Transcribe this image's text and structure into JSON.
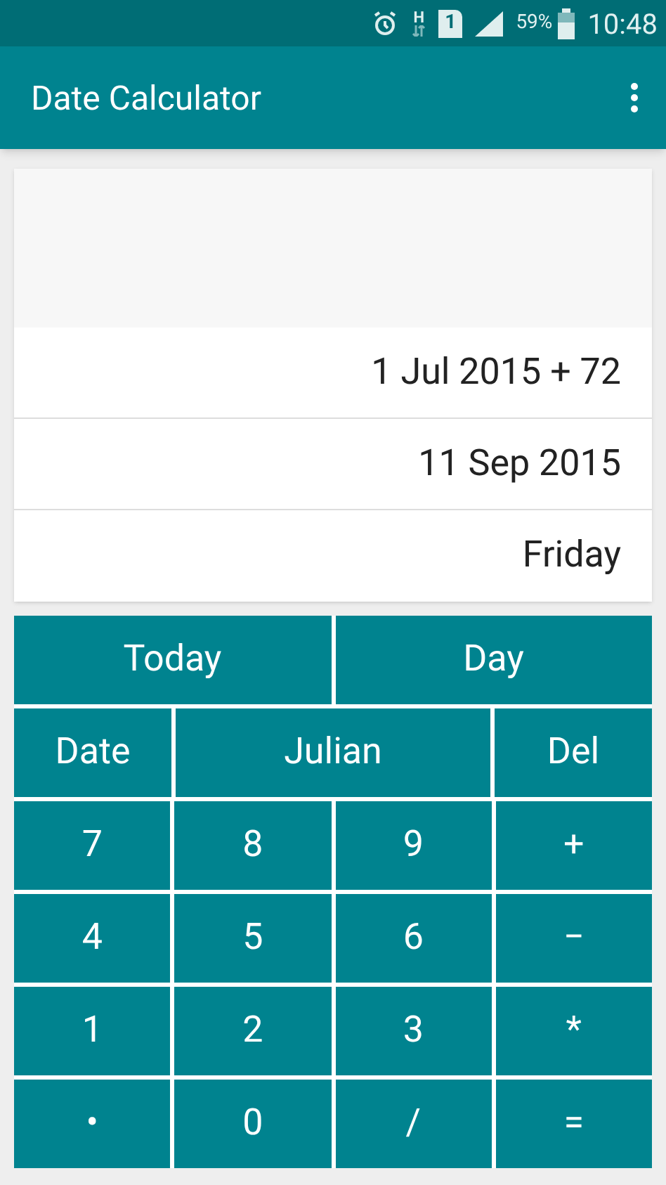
{
  "status_bar": {
    "network": "H",
    "sim": "1",
    "battery": "59%",
    "time": "10:48"
  },
  "app_bar": {
    "title": "Date Calculator"
  },
  "display": {
    "lines": [
      "1 Jul 2015 + 72",
      "11 Sep 2015",
      "Friday"
    ]
  },
  "keypad": {
    "mode_keys": [
      "Today",
      "Day"
    ],
    "function_keys": [
      "Date",
      "Julian",
      "Del"
    ],
    "number_pad": [
      [
        "7",
        "8",
        "9",
        "+"
      ],
      [
        "4",
        "5",
        "6",
        "−"
      ],
      [
        "1",
        "2",
        "3",
        "*"
      ],
      [
        "•",
        "0",
        "/",
        "="
      ]
    ]
  }
}
